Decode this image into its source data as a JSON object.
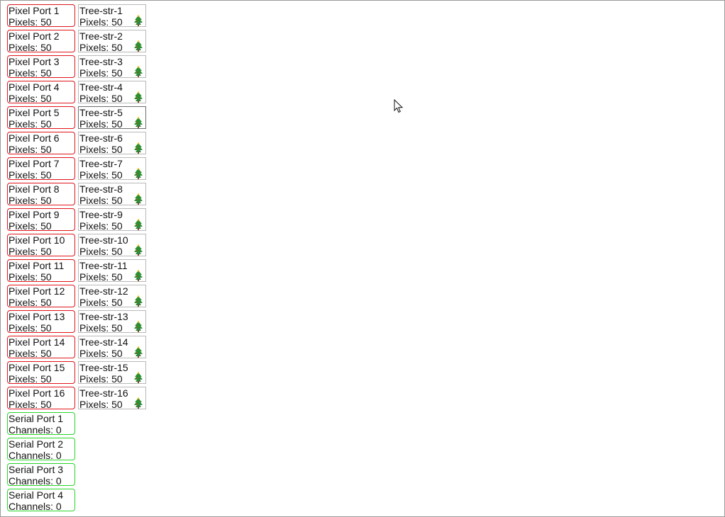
{
  "pixel_ports": [
    {
      "label": "Pixel Port 1",
      "info": "Pixels: 50",
      "model": {
        "label": "Tree-str-1",
        "info": "Pixels: 50",
        "icon": "tree-icon"
      }
    },
    {
      "label": "Pixel Port 2",
      "info": "Pixels: 50",
      "model": {
        "label": "Tree-str-2",
        "info": "Pixels: 50",
        "icon": "tree-icon"
      }
    },
    {
      "label": "Pixel Port 3",
      "info": "Pixels: 50",
      "model": {
        "label": "Tree-str-3",
        "info": "Pixels: 50",
        "icon": "tree-icon"
      }
    },
    {
      "label": "Pixel Port 4",
      "info": "Pixels: 50",
      "model": {
        "label": "Tree-str-4",
        "info": "Pixels: 50",
        "icon": "tree-icon"
      }
    },
    {
      "label": "Pixel Port 5",
      "info": "Pixels: 50",
      "model": {
        "label": "Tree-str-5",
        "info": "Pixels: 50",
        "icon": "tree-icon"
      }
    },
    {
      "label": "Pixel Port 6",
      "info": "Pixels: 50",
      "model": {
        "label": "Tree-str-6",
        "info": "Pixels: 50",
        "icon": "tree-icon"
      }
    },
    {
      "label": "Pixel Port 7",
      "info": "Pixels: 50",
      "model": {
        "label": "Tree-str-7",
        "info": "Pixels: 50",
        "icon": "tree-icon"
      }
    },
    {
      "label": "Pixel Port 8",
      "info": "Pixels: 50",
      "model": {
        "label": "Tree-str-8",
        "info": "Pixels: 50",
        "icon": "tree-icon"
      }
    },
    {
      "label": "Pixel Port 9",
      "info": "Pixels: 50",
      "model": {
        "label": "Tree-str-9",
        "info": "Pixels: 50",
        "icon": "tree-icon"
      }
    },
    {
      "label": "Pixel Port 10",
      "info": "Pixels: 50",
      "model": {
        "label": "Tree-str-10",
        "info": "Pixels: 50",
        "icon": "tree-icon"
      }
    },
    {
      "label": "Pixel Port 11",
      "info": "Pixels: 50",
      "model": {
        "label": "Tree-str-11",
        "info": "Pixels: 50",
        "icon": "tree-icon"
      }
    },
    {
      "label": "Pixel Port 12",
      "info": "Pixels: 50",
      "model": {
        "label": "Tree-str-12",
        "info": "Pixels: 50",
        "icon": "tree-icon"
      }
    },
    {
      "label": "Pixel Port 13",
      "info": "Pixels: 50",
      "model": {
        "label": "Tree-str-13",
        "info": "Pixels: 50",
        "icon": "tree-icon"
      }
    },
    {
      "label": "Pixel Port 14",
      "info": "Pixels: 50",
      "model": {
        "label": "Tree-str-14",
        "info": "Pixels: 50",
        "icon": "tree-icon"
      }
    },
    {
      "label": "Pixel Port 15",
      "info": "Pixels: 50",
      "model": {
        "label": "Tree-str-15",
        "info": "Pixels: 50",
        "icon": "tree-icon"
      }
    },
    {
      "label": "Pixel Port 16",
      "info": "Pixels: 50",
      "model": {
        "label": "Tree-str-16",
        "info": "Pixels: 50",
        "icon": "tree-icon"
      }
    }
  ],
  "serial_ports": [
    {
      "label": "Serial Port 1",
      "info": "Channels: 0"
    },
    {
      "label": "Serial Port 2",
      "info": "Channels: 0"
    },
    {
      "label": "Serial Port 3",
      "info": "Channels: 0"
    },
    {
      "label": "Serial Port 4",
      "info": "Channels: 0"
    }
  ],
  "colors": {
    "pixel_port_border": "#e0151b",
    "serial_port_border": "#29d629",
    "model_border": "#b8b8b8",
    "background": "#ffffff"
  },
  "icons": {
    "model": "tree-icon",
    "pointer": "mouse-cursor-icon"
  }
}
